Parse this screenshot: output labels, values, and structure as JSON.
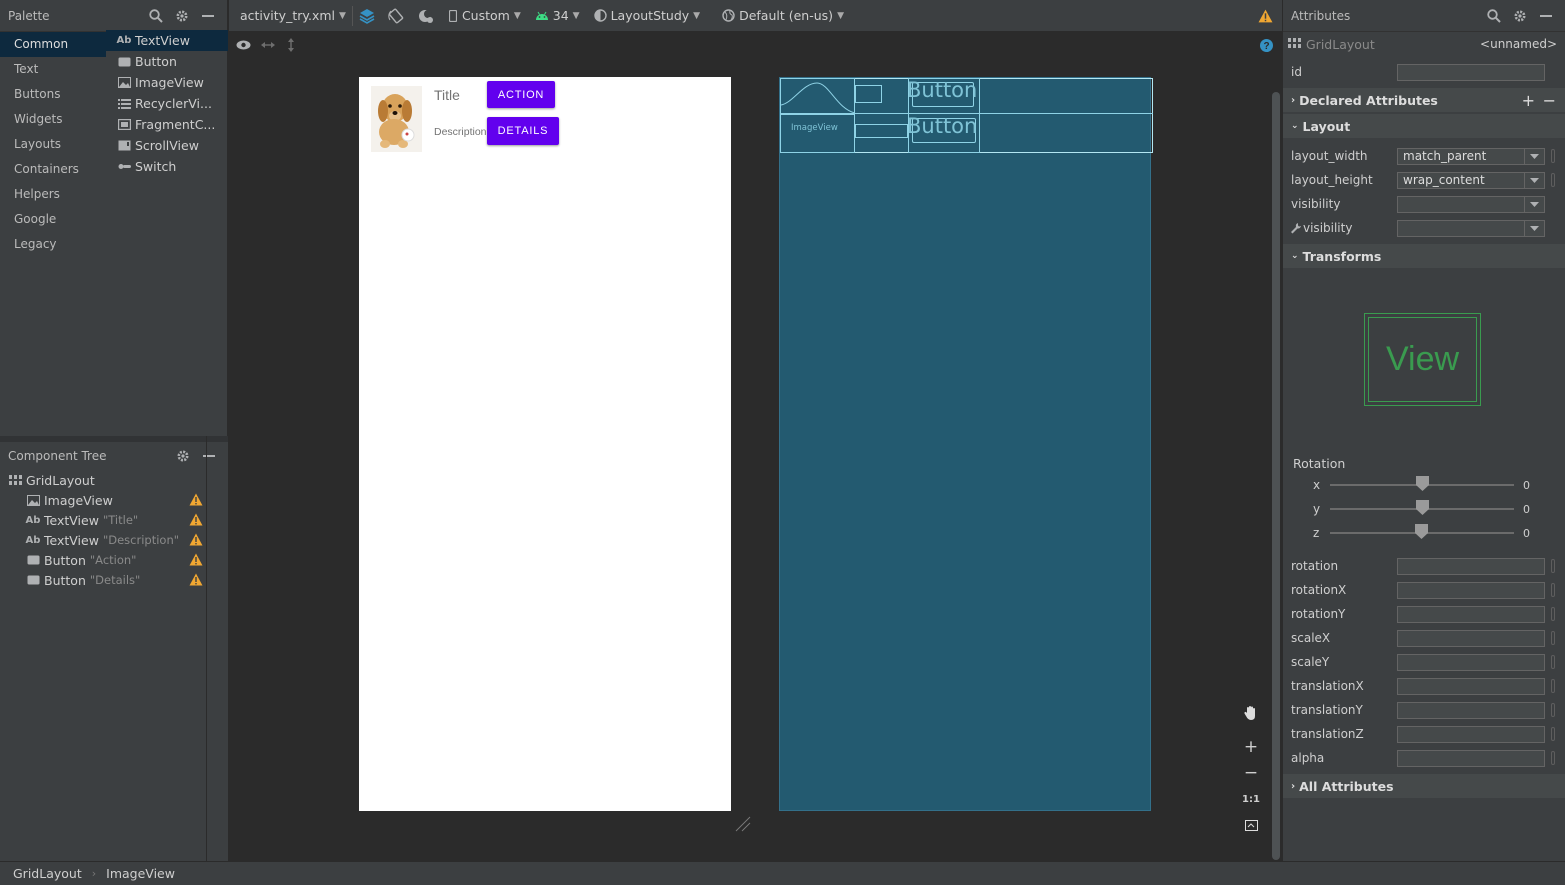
{
  "palette": {
    "title": "Palette",
    "categories": [
      "Common",
      "Text",
      "Buttons",
      "Widgets",
      "Layouts",
      "Containers",
      "Helpers",
      "Google",
      "Legacy"
    ],
    "selected_category": "Common",
    "items": [
      {
        "label": "TextView",
        "icon": "textview-icon"
      },
      {
        "label": "Button",
        "icon": "button-icon"
      },
      {
        "label": "ImageView",
        "icon": "imageview-icon"
      },
      {
        "label": "RecyclerVi...",
        "icon": "list-icon"
      },
      {
        "label": "FragmentC...",
        "icon": "fragment-icon"
      },
      {
        "label": "ScrollView",
        "icon": "scrollview-icon"
      },
      {
        "label": "Switch",
        "icon": "switch-icon"
      }
    ]
  },
  "tree": {
    "title": "Component Tree",
    "root": "GridLayout",
    "children": [
      {
        "type": "ImageView",
        "quote": ""
      },
      {
        "type": "TextView",
        "quote": "\"Title\""
      },
      {
        "type": "TextView",
        "quote": "\"Description\""
      },
      {
        "type": "Button",
        "quote": "\"Action\""
      },
      {
        "type": "Button",
        "quote": "\"Details\""
      }
    ]
  },
  "toolbar": {
    "file": "activity_try.xml",
    "device": "Custom",
    "api": "34",
    "theme": "LayoutStudy",
    "locale": "Default (en-us)"
  },
  "preview": {
    "title": "Title",
    "description": "Description",
    "action_button": "ACTION",
    "details_button": "DETAILS"
  },
  "blueprint": {
    "imageview_label": "ImageView",
    "button_label_1": "Button",
    "button_label_2": "Button"
  },
  "zoom": {
    "one_to_one": "1:1"
  },
  "attributes": {
    "title": "Attributes",
    "component": "GridLayout",
    "component_id": "<unnamed>",
    "id_label": "id",
    "declared": "Declared Attributes",
    "layout_section": "Layout",
    "layout_width_label": "layout_width",
    "layout_width_value": "match_parent",
    "layout_height_label": "layout_height",
    "layout_height_value": "wrap_content",
    "visibility_label": "visibility",
    "tools_visibility_label": "visibility",
    "transforms": "Transforms",
    "view_preview": "View",
    "rotation_title": "Rotation",
    "rot_x_label": "x",
    "rot_x_value": "0",
    "rot_y_label": "y",
    "rot_y_value": "0",
    "rot_z_label": "z",
    "rot_z_value": "0",
    "fields": [
      "rotation",
      "rotationX",
      "rotationY",
      "scaleX",
      "scaleY",
      "translationX",
      "translationY",
      "translationZ",
      "alpha"
    ],
    "all_attributes": "All Attributes"
  },
  "status": {
    "crumb1": "GridLayout",
    "crumb2": "ImageView"
  },
  "colors": {
    "accent_button": "#6200ee",
    "blueprint_bg": "#235a70",
    "selection": "#0d293e",
    "warning": "#f0a732"
  }
}
